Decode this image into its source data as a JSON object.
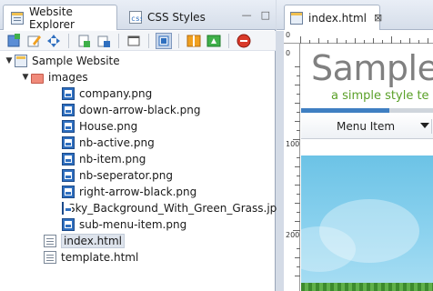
{
  "left_panel": {
    "tabs": [
      {
        "label": "Website Explorer",
        "active": true,
        "icon": "website-explorer-icon"
      },
      {
        "label": "CSS Styles",
        "active": false,
        "icon": "css-styles-icon"
      }
    ],
    "window_buttons": {
      "minimize": "—",
      "maximize": "□"
    },
    "toolbar": [
      "new-file-icon",
      "edit-icon",
      "move-icon",
      "add-page-icon",
      "add-folder-icon",
      "window-icon",
      "view-icon",
      "layout-icon",
      "refresh-icon",
      "stop-icon"
    ],
    "tree": {
      "root": {
        "label": "Sample Website",
        "icon": "site-icon",
        "expanded": true
      },
      "folder": {
        "label": "images",
        "icon": "folder-icon",
        "expanded": true
      },
      "images": [
        "company.png",
        "down-arrow-black.png",
        "House.png",
        "nb-active.png",
        "nb-item.png",
        "nb-seperator.png",
        "right-arrow-black.png",
        "Sky_Background_With_Green_Grass.jpg",
        "sub-menu-item.png"
      ],
      "files": [
        {
          "label": "index.html",
          "selected": true
        },
        {
          "label": "template.html",
          "selected": false
        }
      ]
    }
  },
  "right_panel": {
    "tab": {
      "label": "index.html",
      "close": "⊠"
    },
    "ruler": {
      "h_zero": "0",
      "v_labels": [
        "0",
        "100",
        "200"
      ]
    },
    "preview": {
      "title": "Sample",
      "tagline": "a simple style te",
      "menu_item": "Menu Item"
    }
  },
  "colors": {
    "accent_blue": "#3f7fc2",
    "tagline_green": "#5aa028",
    "title_gray": "#808080",
    "sky": "#6cc3e6"
  }
}
